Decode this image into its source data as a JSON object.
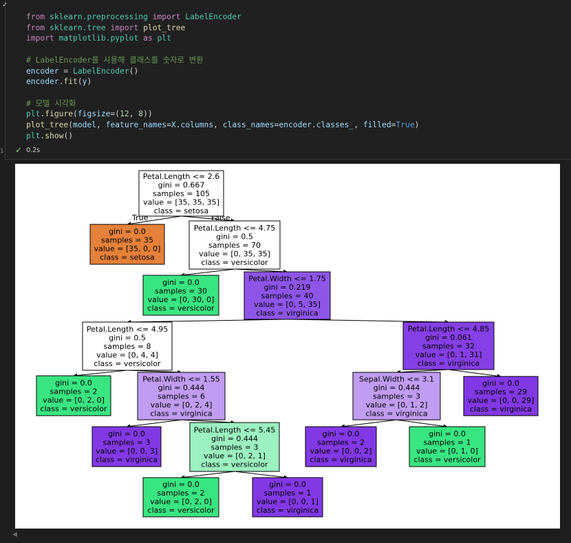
{
  "code_lines": [
    "from sklearn.preprocessing import LabelEncoder",
    "from sklearn.tree import plot_tree",
    "import matplotlib.pyplot as plt",
    "",
    "# LabelEncoder를 사용해 클래스를 숫자로 변환",
    "encoder = LabelEncoder()",
    "encoder.fit(y)",
    "",
    "# 모델 시각화",
    "plt.figure(figsize=(12, 8))",
    "plot_tree(model, feature_names=X.columns, class_names=encoder.classes_, filled=True)",
    "plt.show()"
  ],
  "cell_status": {
    "elapsed": "0.2s",
    "gutter_label": "1"
  },
  "tree": {
    "root_branch_labels": {
      "left": "True",
      "right": "False"
    },
    "nodes": [
      {
        "id": "n0",
        "lines": [
          "Petal.Length <= 2.6",
          "gini = 0.667",
          "samples = 105",
          "value = [35, 35, 35]",
          "class = setosa"
        ],
        "fill": "#ffffff"
      },
      {
        "id": "n1",
        "lines": [
          "gini = 0.0",
          "samples = 35",
          "value = [35, 0, 0]",
          "class = setosa"
        ],
        "fill": "#e58139"
      },
      {
        "id": "n2",
        "lines": [
          "Petal.Length <= 4.75",
          "gini = 0.5",
          "samples = 70",
          "value = [0, 35, 35]",
          "class = versicolor"
        ],
        "fill": "#ffffff"
      },
      {
        "id": "n3",
        "lines": [
          "gini = 0.0",
          "samples = 30",
          "value = [0, 30, 0]",
          "class = versicolor"
        ],
        "fill": "#39e581"
      },
      {
        "id": "n4",
        "lines": [
          "Petal.Width <= 1.75",
          "gini = 0.219",
          "samples = 40",
          "value = [0, 5, 35]",
          "class = virginica"
        ],
        "fill": "#8e55e9"
      },
      {
        "id": "n5",
        "lines": [
          "Petal.Length <= 4.95",
          "gini = 0.5",
          "samples = 8",
          "value = [0, 4, 4]",
          "class = versicolor"
        ],
        "fill": "#ffffff"
      },
      {
        "id": "n6",
        "lines": [
          "Petal.Length <= 4.85",
          "gini = 0.061",
          "samples = 32",
          "value = [0, 1, 31]",
          "class = virginica"
        ],
        "fill": "#853fe6"
      },
      {
        "id": "n7",
        "lines": [
          "gini = 0.0",
          "samples = 2",
          "value = [0, 2, 0]",
          "class = versicolor"
        ],
        "fill": "#39e581"
      },
      {
        "id": "n8",
        "lines": [
          "Petal.Width <= 1.55",
          "gini = 0.444",
          "samples = 6",
          "value = [0, 2, 4]",
          "class = virginica"
        ],
        "fill": "#c09cf2"
      },
      {
        "id": "n9",
        "lines": [
          "Sepal.Width <= 3.1",
          "gini = 0.444",
          "samples = 3",
          "value = [0, 1, 2]",
          "class = virginica"
        ],
        "fill": "#c09cf2"
      },
      {
        "id": "n10",
        "lines": [
          "gini = 0.0",
          "samples = 29",
          "value = [0, 0, 29]",
          "class = virginica"
        ],
        "fill": "#8139e5"
      },
      {
        "id": "n11",
        "lines": [
          "gini = 0.0",
          "samples = 3",
          "value = [0, 0, 3]",
          "class = virginica"
        ],
        "fill": "#8139e5"
      },
      {
        "id": "n12",
        "lines": [
          "Petal.Length <= 5.45",
          "gini = 0.444",
          "samples = 3",
          "value = [0, 2, 1]",
          "class = versicolor"
        ],
        "fill": "#9cf2c0"
      },
      {
        "id": "n13",
        "lines": [
          "gini = 0.0",
          "samples = 2",
          "value = [0, 0, 2]",
          "class = virginica"
        ],
        "fill": "#8139e5"
      },
      {
        "id": "n14",
        "lines": [
          "gini = 0.0",
          "samples = 1",
          "value = [0, 1, 0]",
          "class = versicolor"
        ],
        "fill": "#39e581"
      },
      {
        "id": "n15",
        "lines": [
          "gini = 0.0",
          "samples = 2",
          "value = [0, 2, 0]",
          "class = versicolor"
        ],
        "fill": "#39e581"
      },
      {
        "id": "n16",
        "lines": [
          "gini = 0.0",
          "samples = 1",
          "value = [0, 0, 1]",
          "class = virginica"
        ],
        "fill": "#8139e5"
      }
    ],
    "edges": [
      [
        "n0",
        "n1"
      ],
      [
        "n0",
        "n2"
      ],
      [
        "n2",
        "n3"
      ],
      [
        "n2",
        "n4"
      ],
      [
        "n4",
        "n5"
      ],
      [
        "n4",
        "n6"
      ],
      [
        "n5",
        "n7"
      ],
      [
        "n5",
        "n8"
      ],
      [
        "n8",
        "n11"
      ],
      [
        "n8",
        "n12"
      ],
      [
        "n12",
        "n15"
      ],
      [
        "n12",
        "n16"
      ],
      [
        "n6",
        "n9"
      ],
      [
        "n6",
        "n10"
      ],
      [
        "n9",
        "n13"
      ],
      [
        "n9",
        "n14"
      ]
    ]
  }
}
